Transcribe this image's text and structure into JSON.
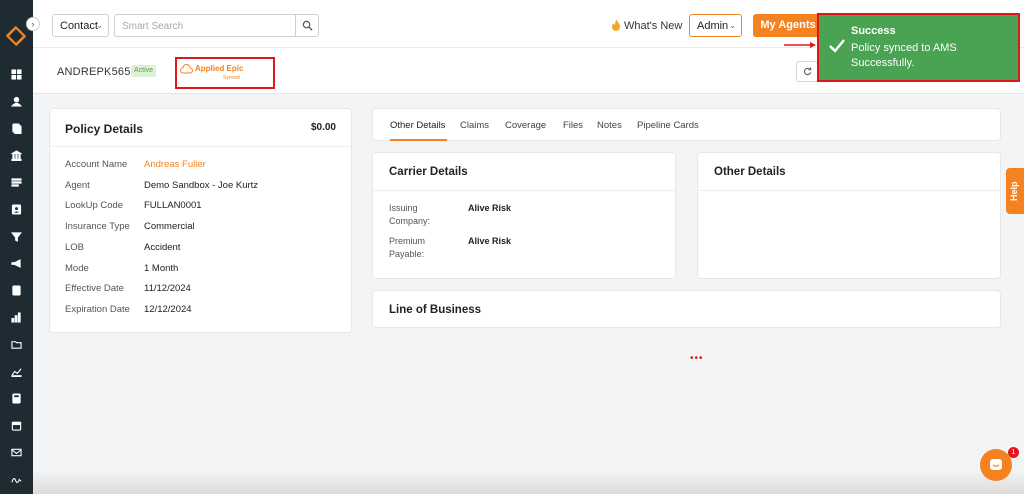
{
  "sidebar": {
    "logo": "company-logo",
    "icons": [
      "dashboard-icon",
      "contacts-icon",
      "policies-icon",
      "bank-icon",
      "list-icon",
      "contact-card-icon",
      "filter-icon",
      "megaphone-icon",
      "document-icon",
      "analytics-icon",
      "folder-icon",
      "reports-icon",
      "calculator-icon",
      "calendar-icon",
      "email-icon",
      "signature-icon"
    ]
  },
  "header": {
    "contact_select": "Contact",
    "search_placeholder": "Smart Search",
    "whats_new": "What's New",
    "admin_select": "Admin",
    "my_agents": "My Agents"
  },
  "policy_header": {
    "policy_number": "ANDREPK5656",
    "status": "Active",
    "sync_title": "Applied Epic",
    "sync_status": "Synced"
  },
  "policy_details": {
    "title": "Policy Details",
    "amount": "$0.00",
    "rows": [
      {
        "label": "Account Name",
        "value": "Andreas Fuller"
      },
      {
        "label": "Agent",
        "value": "Demo Sandbox - Joe Kurtz"
      },
      {
        "label": "LookUp Code",
        "value": "FULLAN0001"
      },
      {
        "label": "Insurance Type",
        "value": "Commercial"
      },
      {
        "label": "LOB",
        "value": "Accident"
      },
      {
        "label": "Mode",
        "value": "1 Month"
      },
      {
        "label": "Effective Date",
        "value": "11/12/2024"
      },
      {
        "label": "Expiration Date",
        "value": "12/12/2024"
      }
    ]
  },
  "tabs": [
    "Other Details",
    "Claims",
    "Coverage",
    "Files",
    "Notes",
    "Pipeline Cards"
  ],
  "carrier_details": {
    "title": "Carrier Details",
    "rows": [
      {
        "label": "Issuing Company:",
        "value": "Alive Risk"
      },
      {
        "label": "Premium Payable:",
        "value": "Alive Risk"
      }
    ]
  },
  "other_details": {
    "title": "Other Details"
  },
  "line_of_business": {
    "title": "Line of Business"
  },
  "help_tab": "Help",
  "chat": {
    "badge": "1"
  },
  "toast": {
    "title": "Success",
    "message": "Policy synced to AMS Successfully."
  },
  "colors": {
    "accent": "#f58220",
    "sidebar": "#1f2b33",
    "toast": "#4aa352",
    "highlight": "#e0161c"
  }
}
